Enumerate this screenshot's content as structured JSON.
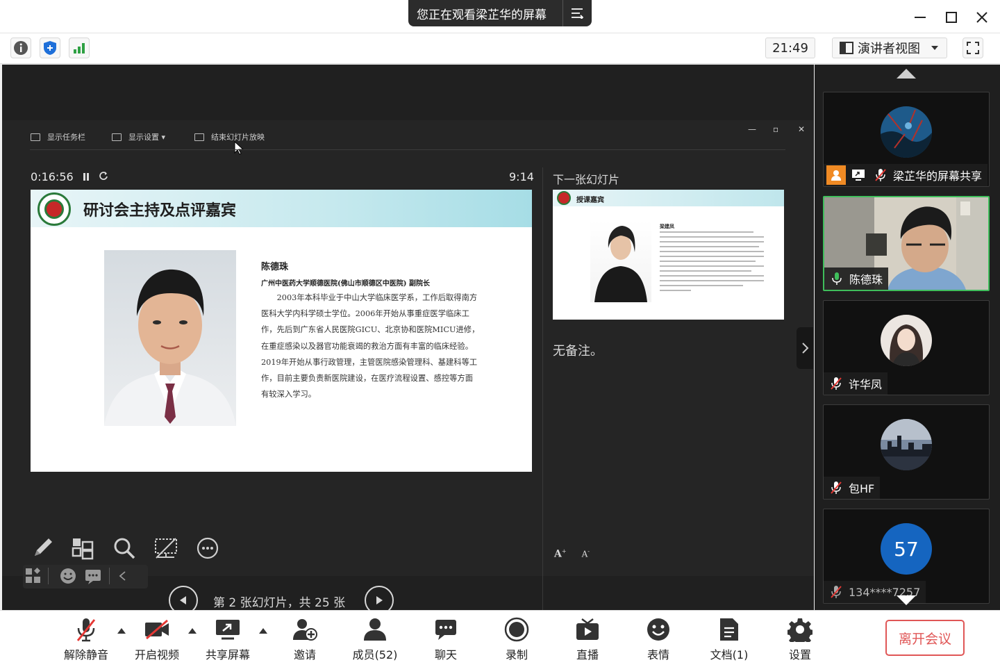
{
  "titlebar": {
    "banner": "您正在观看梁芷华的屏幕"
  },
  "subbar": {
    "time": "21:49",
    "view_mode": "演讲者视图"
  },
  "presenter": {
    "toolbar": {
      "show_taskbar": "显示任务栏",
      "display_settings": "显示设置 ▾",
      "end_show": "结束幻灯片放映"
    },
    "elapsed": "0:16:56",
    "clock": "9:14",
    "slide": {
      "title": "研讨会主持及点评嘉宾",
      "name": "陈德珠",
      "org": "广州中医药大学顺德医院(佛山市顺德区中医院) 副院长",
      "bio": "2003年本科毕业于中山大学临床医学系，工作后取得南方医科大学内科学硕士学位。2006年开始从事重症医学临床工作，先后到广东省人民医院GICU、北京协和医院MICU进修，在重症感染以及器官功能衰竭的救治方面有丰富的临床经验。2019年开始从事行政管理，主管医院感染管理科、基建科等工作，目前主要负责新医院建设，在医疗流程设置、感控等方面有较深入学习。"
    },
    "slide_counter": "第 2 张幻灯片，共 25 张",
    "progress": 0.08,
    "next_label": "下一张幻灯片",
    "next_slide": {
      "title": "授课嘉宾",
      "name": "梁建凤"
    },
    "notes": "无备注。",
    "font_controls": [
      "A",
      "A"
    ]
  },
  "participants": [
    {
      "name": "梁芷华的屏幕共享"
    },
    {
      "name": "陈德珠"
    },
    {
      "name": "许华凤"
    },
    {
      "name": "包HF"
    },
    {
      "name": "134****7257",
      "avatar_text": "57"
    }
  ],
  "bottom": {
    "unmute": "解除静音",
    "video": "开启视频",
    "share": "共享屏幕",
    "invite": "邀请",
    "members": "成员(52)",
    "chat": "聊天",
    "record": "录制",
    "live": "直播",
    "emoji": "表情",
    "docs": "文档(1)",
    "settings": "设置",
    "leave": "离开会议"
  },
  "colors": {
    "accent_green": "#3fbe5b",
    "leave_red": "#e05656",
    "badge_blue": "#1565c0",
    "share_orange": "#f08a24"
  }
}
